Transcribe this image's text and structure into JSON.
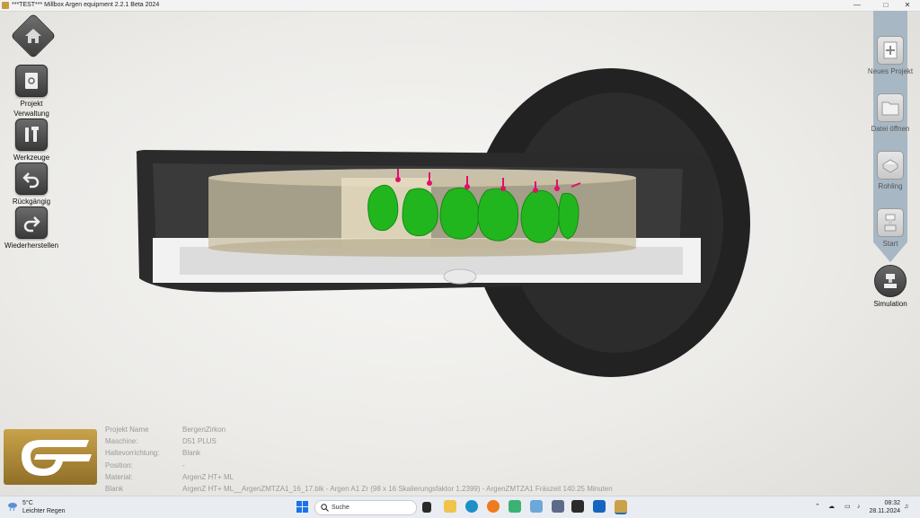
{
  "window": {
    "title": "***TEST*** Millbox Argen equipment 2.2.1 Beta 2024",
    "controls": [
      "—",
      "□",
      "✕"
    ]
  },
  "left_toolbar": {
    "items": [
      {
        "name": "projekt-verwaltung",
        "label_line1": "Projekt",
        "label_line2": "Verwaltung",
        "icon": "project-icon"
      },
      {
        "name": "werkzeuge",
        "label_line1": "Werkzeuge",
        "label_line2": "",
        "icon": "tools-icon"
      },
      {
        "name": "rueckgaengig",
        "label_line1": "Rückgängig",
        "label_line2": "",
        "icon": "undo-icon"
      },
      {
        "name": "wiederherstellen",
        "label_line1": "Wiederherstellen",
        "label_line2": "",
        "icon": "redo-icon"
      }
    ]
  },
  "right_toolbar": {
    "items": [
      {
        "label": "Neues Projekt",
        "icon": "new-project-icon"
      },
      {
        "label": "Datei öffnen",
        "icon": "open-file-icon"
      },
      {
        "label": "Rohling",
        "icon": "blank-icon"
      },
      {
        "label": "Start",
        "icon": "start-icon"
      },
      {
        "label": "Simulation",
        "icon": "simulation-icon",
        "active": true
      }
    ]
  },
  "project_info": {
    "rows": [
      {
        "key": "Projekt Name",
        "value": "BergenZirkon"
      },
      {
        "key": "Maschine:",
        "value": "D51 PLUS"
      },
      {
        "key": "Haltevorrichtung:",
        "value": "Blank"
      },
      {
        "key": "Position:",
        "value": "-"
      },
      {
        "key": "Material:",
        "value": "ArgenZ HT+ ML"
      },
      {
        "key": "Blank",
        "value": "ArgenZ HT+ ML__ArgenZMTZA1_16_17.blk - Argen A1 Zr (98 x 16 Skalierungsfaktor 1.2399) - ArgenZMTZA1 Fräszeit 140.25 Minuten"
      }
    ]
  },
  "taskbar": {
    "weather_temp": "5°C",
    "weather_desc": "Leichter Regen",
    "search_label": "Suche",
    "time": "08:32",
    "date": "28.11.2024"
  },
  "colors": {
    "accent_gold": "#c9a24a",
    "rail": "#a8b7c4",
    "teeth": "#22b61e",
    "markers": "#e0106a"
  }
}
